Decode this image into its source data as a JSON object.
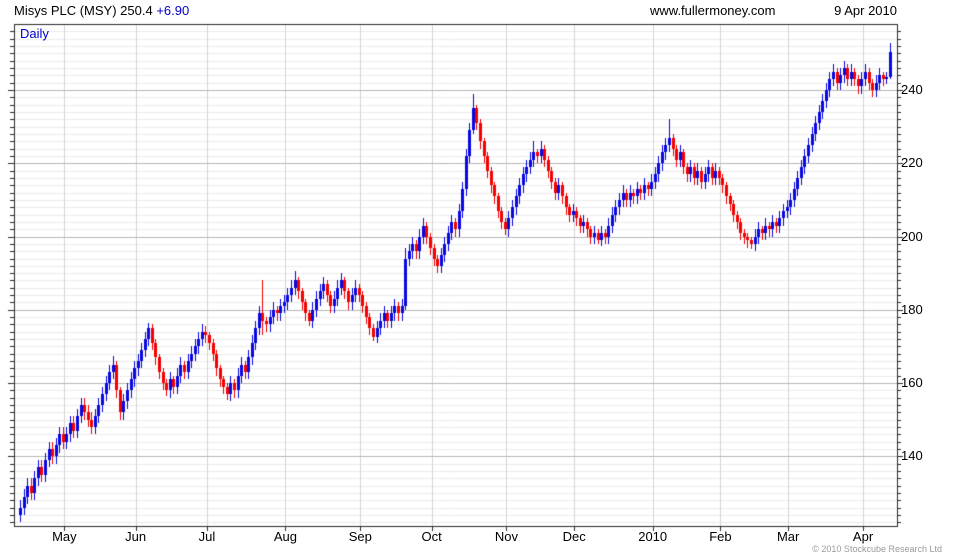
{
  "header": {
    "title": "Misys PLC (MSY) 250.4",
    "change": "+6.90",
    "site": "www.fullermoney.com",
    "date": "9 Apr 2010"
  },
  "chart": {
    "timeframe_label": "Daily"
  },
  "footer": {
    "copyright": "© 2010 Stockcube Research Ltd"
  },
  "colors": {
    "up": "#0808e0",
    "down": "#f40000",
    "border": "#2a2a2a",
    "grid_major": "#b8b8b8",
    "grid_minor": "#ececec",
    "grid_month": "#d4d4d4",
    "accent_blue": "#0000c8",
    "copyright_gray": "#9a9a9a"
  },
  "chart_data": {
    "type": "candlestick",
    "instrument": "Misys PLC",
    "ticker": "MSY",
    "timeframe": "Daily",
    "last_price": 250.4,
    "change": 6.9,
    "y_ticks": [
      140,
      160,
      180,
      200,
      220,
      240
    ],
    "y_minor_step": 2,
    "ylim": [
      121,
      258
    ],
    "x_labels": [
      "May",
      "Jun",
      "Jul",
      "Aug",
      "Sep",
      "Oct",
      "Nov",
      "Dec",
      "2010",
      "Feb",
      "Mar",
      "Apr"
    ],
    "month_start_indices": [
      13,
      33,
      53,
      75,
      96,
      116,
      137,
      156,
      178,
      197,
      216,
      237
    ],
    "candles": [
      [
        124,
        128,
        122,
        126
      ],
      [
        126,
        131,
        124,
        129
      ],
      [
        129,
        134,
        127,
        132
      ],
      [
        132,
        134,
        128,
        130
      ],
      [
        130,
        136,
        128,
        134
      ],
      [
        134,
        139,
        132,
        137
      ],
      [
        137,
        139,
        133,
        135
      ],
      [
        135,
        141,
        133,
        139
      ],
      [
        139,
        144,
        137,
        142
      ],
      [
        142,
        144,
        138,
        140
      ],
      [
        140,
        145,
        138,
        143
      ],
      [
        143,
        148,
        141,
        146
      ],
      [
        146,
        148,
        142,
        144
      ],
      [
        144,
        148,
        142,
        146
      ],
      [
        146,
        151,
        144,
        149
      ],
      [
        149,
        151,
        145,
        147
      ],
      [
        147,
        153,
        145,
        151
      ],
      [
        151,
        156,
        149,
        154
      ],
      [
        154,
        156,
        150,
        152
      ],
      [
        152,
        154,
        148,
        150
      ],
      [
        150,
        152,
        146,
        148
      ],
      [
        148,
        153,
        146,
        151
      ],
      [
        151,
        156,
        149,
        154
      ],
      [
        154,
        159,
        152,
        157
      ],
      [
        157,
        162,
        155,
        160
      ],
      [
        160,
        165,
        158,
        163
      ],
      [
        163,
        167.5,
        161,
        165
      ],
      [
        165,
        166,
        156,
        158
      ],
      [
        158,
        159,
        150,
        152
      ],
      [
        152,
        157,
        150,
        155
      ],
      [
        155,
        160,
        153,
        158
      ],
      [
        158,
        163,
        156,
        161
      ],
      [
        161,
        166,
        159,
        164
      ],
      [
        164,
        168,
        162,
        166
      ],
      [
        166,
        171,
        164,
        169
      ],
      [
        169,
        174,
        167,
        172
      ],
      [
        172,
        176.5,
        170,
        175
      ],
      [
        175,
        176,
        169,
        171
      ],
      [
        171,
        172,
        165,
        167
      ],
      [
        167,
        168,
        161,
        163
      ],
      [
        163,
        164,
        158,
        160
      ],
      [
        160,
        161,
        156.5,
        158
      ],
      [
        158,
        163,
        156,
        161
      ],
      [
        161,
        162,
        157,
        159
      ],
      [
        159,
        164,
        157,
        162
      ],
      [
        162,
        167,
        160,
        165
      ],
      [
        165,
        166,
        161,
        163
      ],
      [
        163,
        168,
        161,
        166
      ],
      [
        166,
        170,
        164,
        168
      ],
      [
        168,
        172,
        166,
        170
      ],
      [
        170,
        174,
        168,
        172
      ],
      [
        172,
        176,
        170,
        174
      ],
      [
        174,
        175.5,
        171,
        173
      ],
      [
        173,
        174,
        169,
        171
      ],
      [
        171,
        172,
        166,
        168
      ],
      [
        168,
        169,
        162,
        164
      ],
      [
        164,
        165,
        159,
        161
      ],
      [
        161,
        162,
        157,
        159
      ],
      [
        159,
        160,
        155.5,
        157
      ],
      [
        157,
        162,
        155,
        160
      ],
      [
        160,
        161,
        156,
        158
      ],
      [
        158,
        164,
        156,
        162
      ],
      [
        162,
        167,
        160,
        165
      ],
      [
        165,
        166,
        161,
        163
      ],
      [
        163,
        169,
        161,
        167
      ],
      [
        167,
        173,
        165,
        171
      ],
      [
        171,
        177,
        169,
        175
      ],
      [
        175,
        181,
        173,
        179
      ],
      [
        179,
        188,
        173,
        177
      ],
      [
        177,
        178,
        174,
        176
      ],
      [
        176,
        180,
        174,
        178
      ],
      [
        178,
        182,
        176,
        180
      ],
      [
        180,
        181,
        177,
        179
      ],
      [
        179,
        183,
        177,
        181
      ],
      [
        181,
        184,
        179,
        182
      ],
      [
        182,
        186,
        180,
        184
      ],
      [
        184,
        188,
        182,
        186
      ],
      [
        186,
        190.5,
        184,
        188
      ],
      [
        188,
        189,
        183,
        185
      ],
      [
        185,
        186,
        180,
        182
      ],
      [
        182,
        183,
        177,
        179
      ],
      [
        179,
        180,
        175.5,
        177
      ],
      [
        177,
        182,
        175,
        180
      ],
      [
        180,
        185,
        178,
        183
      ],
      [
        183,
        187,
        181,
        185
      ],
      [
        185,
        189,
        183,
        187
      ],
      [
        187,
        188,
        182,
        184
      ],
      [
        184,
        185,
        179,
        181
      ],
      [
        181,
        185,
        179,
        183
      ],
      [
        183,
        188,
        181,
        186
      ],
      [
        186,
        190,
        184,
        188
      ],
      [
        188,
        189,
        183,
        185
      ],
      [
        185,
        186,
        180,
        182
      ],
      [
        182,
        186,
        180,
        184
      ],
      [
        184,
        188,
        182,
        186
      ],
      [
        186,
        187,
        182,
        184
      ],
      [
        184,
        185,
        179,
        181
      ],
      [
        181,
        182,
        176,
        178
      ],
      [
        178,
        179,
        173,
        175
      ],
      [
        175,
        176,
        171.5,
        172.5
      ],
      [
        172.5,
        177,
        171,
        175
      ],
      [
        175,
        179,
        173,
        177
      ],
      [
        177,
        181,
        175,
        179
      ],
      [
        179,
        180,
        175,
        177
      ],
      [
        177,
        181,
        175,
        179
      ],
      [
        179,
        183,
        177,
        181
      ],
      [
        181,
        182,
        177,
        179
      ],
      [
        179,
        183,
        177,
        181
      ],
      [
        181,
        197,
        180,
        194
      ],
      [
        194,
        198,
        192,
        196
      ],
      [
        196,
        200,
        194,
        198
      ],
      [
        198,
        199,
        194,
        196
      ],
      [
        196,
        202,
        194,
        200
      ],
      [
        200,
        205,
        198,
        203
      ],
      [
        203,
        204,
        198,
        200
      ],
      [
        200,
        201,
        195,
        197
      ],
      [
        197,
        198,
        192,
        194
      ],
      [
        194,
        195,
        190,
        192
      ],
      [
        192,
        197,
        190,
        195
      ],
      [
        195,
        200,
        193,
        198
      ],
      [
        198,
        203,
        196,
        201
      ],
      [
        201,
        206,
        199,
        204
      ],
      [
        204,
        205,
        200,
        202
      ],
      [
        202,
        209,
        200,
        207
      ],
      [
        207,
        215,
        205,
        213
      ],
      [
        213,
        224,
        211,
        222
      ],
      [
        222,
        231,
        220,
        229
      ],
      [
        229,
        239,
        228,
        235
      ],
      [
        235,
        236,
        229,
        231
      ],
      [
        231,
        232,
        224,
        226
      ],
      [
        226,
        227,
        220,
        222
      ],
      [
        222,
        223,
        216,
        218
      ],
      [
        218,
        219,
        212,
        214
      ],
      [
        214,
        215,
        209,
        211
      ],
      [
        211,
        212,
        205,
        207
      ],
      [
        207,
        208,
        202,
        204
      ],
      [
        204,
        205,
        200.5,
        202
      ],
      [
        202,
        207,
        200,
        205
      ],
      [
        205,
        210,
        203,
        208
      ],
      [
        208,
        213,
        206,
        211
      ],
      [
        211,
        216,
        209,
        214
      ],
      [
        214,
        219,
        212,
        217
      ],
      [
        217,
        221,
        215,
        219
      ],
      [
        219,
        223,
        217,
        221
      ],
      [
        221,
        226,
        219,
        223
      ],
      [
        223,
        224,
        220,
        222
      ],
      [
        222,
        226,
        220,
        224
      ],
      [
        224,
        225,
        219,
        221
      ],
      [
        221,
        222,
        216,
        218
      ],
      [
        218,
        219,
        213,
        215
      ],
      [
        215,
        216,
        210,
        212
      ],
      [
        212,
        216,
        210,
        214
      ],
      [
        214,
        215,
        209,
        211
      ],
      [
        211,
        212,
        206,
        208
      ],
      [
        208,
        209,
        204,
        206
      ],
      [
        206,
        209,
        204,
        207
      ],
      [
        207,
        208,
        203,
        205
      ],
      [
        205,
        206,
        201,
        203
      ],
      [
        203,
        206,
        201,
        204
      ],
      [
        204,
        205,
        200,
        202
      ],
      [
        202,
        203,
        198,
        200
      ],
      [
        200,
        203,
        198,
        201
      ],
      [
        201,
        202,
        198,
        199
      ],
      [
        199,
        203,
        197.5,
        201
      ],
      [
        201,
        202,
        198,
        200
      ],
      [
        200,
        205,
        198,
        203
      ],
      [
        203,
        208,
        201,
        206
      ],
      [
        206,
        210,
        204,
        208
      ],
      [
        208,
        212,
        206,
        210
      ],
      [
        210,
        214,
        208,
        212
      ],
      [
        212,
        213,
        208,
        210
      ],
      [
        210,
        214,
        208,
        212
      ],
      [
        212,
        213,
        209,
        211
      ],
      [
        211,
        215,
        209,
        213
      ],
      [
        213,
        214,
        210,
        212
      ],
      [
        212,
        216,
        210,
        214
      ],
      [
        214,
        215,
        211,
        213
      ],
      [
        213,
        217,
        211,
        215
      ],
      [
        215,
        219,
        213,
        217
      ],
      [
        217,
        222,
        215,
        220
      ],
      [
        220,
        225,
        218,
        223
      ],
      [
        223,
        227,
        221,
        225
      ],
      [
        225,
        232,
        223,
        227
      ],
      [
        227,
        228,
        222,
        224
      ],
      [
        224,
        225,
        219,
        221
      ],
      [
        221,
        225,
        219,
        223
      ],
      [
        223,
        224,
        217,
        219
      ],
      [
        219,
        220,
        215,
        217
      ],
      [
        217,
        221,
        215,
        219
      ],
      [
        219,
        220,
        214,
        216
      ],
      [
        216,
        220,
        214,
        218
      ],
      [
        218,
        219,
        213,
        215
      ],
      [
        215,
        219,
        213,
        217
      ],
      [
        217,
        221,
        215,
        219
      ],
      [
        219,
        220,
        214,
        216
      ],
      [
        216,
        220,
        214,
        218
      ],
      [
        218,
        219,
        214,
        216
      ],
      [
        216,
        217,
        212,
        214
      ],
      [
        214,
        215,
        209,
        211
      ],
      [
        211,
        212,
        207,
        209
      ],
      [
        209,
        210,
        204,
        206
      ],
      [
        206,
        207,
        202,
        204
      ],
      [
        204,
        205,
        199,
        201
      ],
      [
        201,
        202,
        198,
        200
      ],
      [
        200,
        201,
        197,
        199
      ],
      [
        199,
        200,
        196.5,
        198
      ],
      [
        198,
        202,
        196,
        200
      ],
      [
        200,
        204,
        198,
        202
      ],
      [
        202,
        203,
        199,
        201
      ],
      [
        201,
        205,
        199,
        203
      ],
      [
        203,
        204,
        200,
        202
      ],
      [
        202,
        206,
        200,
        204
      ],
      [
        204,
        205,
        201,
        203
      ],
      [
        203,
        207,
        201,
        205
      ],
      [
        205,
        209,
        203,
        207
      ],
      [
        207,
        210,
        205,
        208
      ],
      [
        208,
        212,
        206,
        210
      ],
      [
        210,
        215,
        208,
        213
      ],
      [
        213,
        218,
        211,
        216
      ],
      [
        216,
        221,
        214,
        219
      ],
      [
        219,
        224,
        217,
        222
      ],
      [
        222,
        227,
        220,
        225
      ],
      [
        225,
        230,
        223,
        228
      ],
      [
        228,
        233,
        226,
        231
      ],
      [
        231,
        236,
        229,
        234
      ],
      [
        234,
        239,
        232,
        237
      ],
      [
        237,
        242,
        235,
        240
      ],
      [
        240,
        245,
        238,
        243
      ],
      [
        243,
        247,
        241,
        245
      ],
      [
        245,
        246,
        240,
        242
      ],
      [
        242,
        246,
        240,
        244
      ],
      [
        244,
        248,
        242,
        246
      ],
      [
        246,
        247,
        241,
        243
      ],
      [
        243,
        247,
        241,
        245
      ],
      [
        245,
        246,
        241,
        243
      ],
      [
        243,
        244,
        239,
        241
      ],
      [
        241,
        245,
        239,
        243
      ],
      [
        243,
        247,
        241,
        245
      ],
      [
        245,
        246,
        240,
        242
      ],
      [
        242,
        243,
        238,
        240
      ],
      [
        240,
        244,
        238,
        242
      ],
      [
        242,
        246,
        240,
        244
      ],
      [
        244,
        245,
        241,
        243
      ],
      [
        243,
        245,
        241.5,
        243.5
      ],
      [
        243.5,
        252.8,
        243,
        250.4
      ]
    ]
  }
}
